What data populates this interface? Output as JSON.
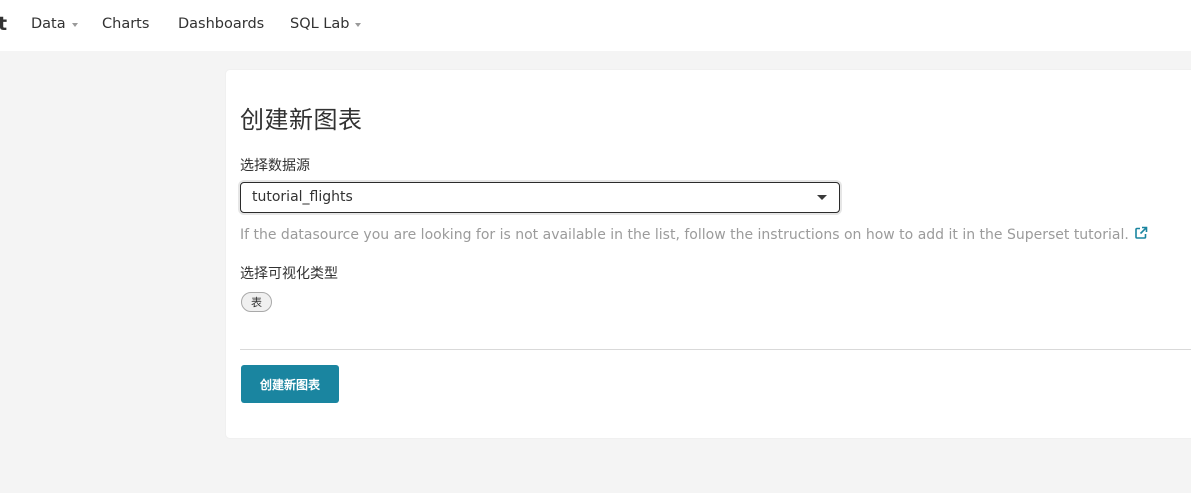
{
  "navbar": {
    "brand": "t",
    "items": [
      {
        "label": "Data",
        "has_dropdown": true
      },
      {
        "label": "Charts",
        "has_dropdown": false
      },
      {
        "label": "Dashboards",
        "has_dropdown": false
      },
      {
        "label": "SQL Lab",
        "has_dropdown": true
      }
    ]
  },
  "main": {
    "title": "创建新图表",
    "datasource": {
      "label": "选择数据源",
      "selected": "tutorial_flights",
      "help_text": "If the datasource you are looking for is not available in the list, follow the instructions on how to add it in the Superset tutorial.",
      "help_link_icon": "external-link-icon"
    },
    "viz_type": {
      "label": "选择可视化类型",
      "selected": "表"
    },
    "create_button": "创建新图表"
  },
  "colors": {
    "primary": "#1a85a0",
    "background": "#f4f4f4",
    "muted_text": "#9b9b9b"
  }
}
